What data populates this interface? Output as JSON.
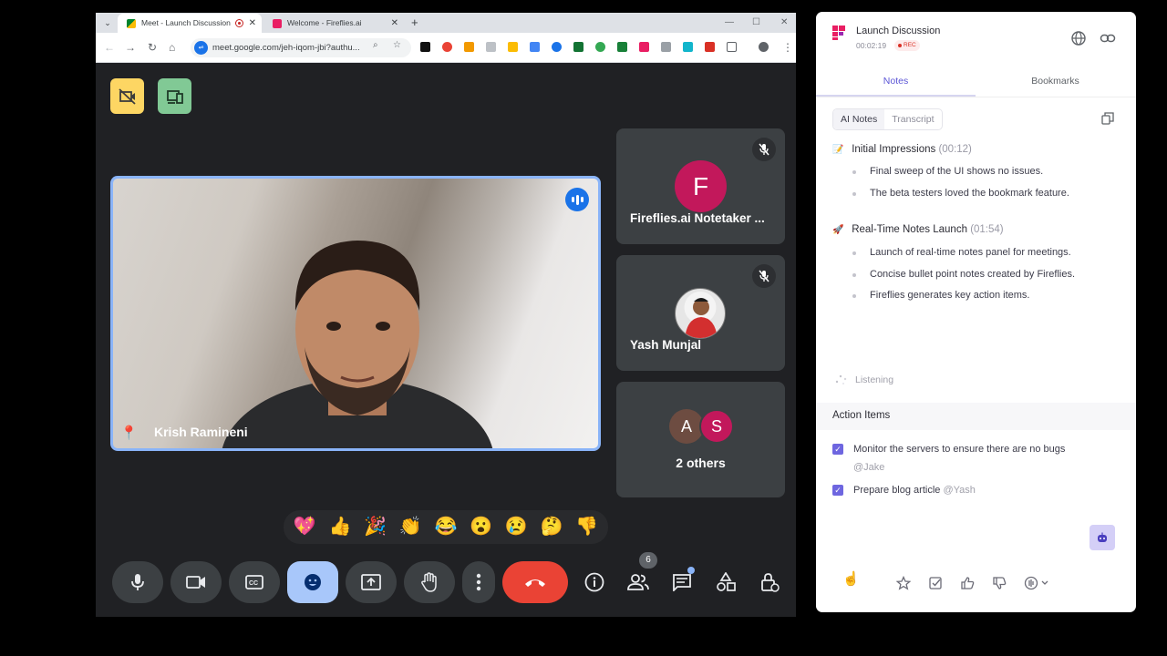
{
  "browser": {
    "tabs": [
      {
        "title": "Meet - Launch Discussion",
        "active": true
      },
      {
        "title": "Welcome - Fireflies.ai",
        "active": false
      }
    ],
    "url": "meet.google.com/jeh-iqom-jbi?authu...",
    "new_tab_label": "+",
    "close_glyph": "✕"
  },
  "meet": {
    "main_participant": {
      "name": "Krish Ramineni",
      "speaking": true
    },
    "side_tiles": [
      {
        "avatar_letter": "F",
        "avatar_color": "#c2185b",
        "name": "Fireflies.ai Notetaker ...",
        "muted": true
      },
      {
        "name": "Yash Munjal",
        "muted": true,
        "avatar": "photo"
      }
    ],
    "others": {
      "letters": [
        "A",
        "S"
      ],
      "colors": [
        "#6d4c41",
        "#c2185b"
      ],
      "label": "2 others"
    },
    "reactions": [
      "💖",
      "👍",
      "🎉",
      "👏",
      "😂",
      "😮",
      "😢",
      "🤔",
      "👎"
    ],
    "people_count": "6",
    "controls": [
      "mic-icon",
      "camera-icon",
      "captions-icon",
      "emoji-icon",
      "present-icon",
      "raise-hand-icon",
      "more-icon",
      "end-call-icon",
      "info-icon",
      "people-icon",
      "chat-icon",
      "activities-icon",
      "host-controls-icon"
    ],
    "colors": {
      "leave": "#ea4335",
      "active_control": "#a8c7fa",
      "tile_border": "#8ab4f8"
    }
  },
  "panel": {
    "title": "Launch Discussion",
    "timer": "00:02:19",
    "rec_label": "REC",
    "tabs": [
      "Notes",
      "Bookmarks"
    ],
    "segments": [
      "AI Notes",
      "Transcript"
    ],
    "sections": [
      {
        "emoji": "📝",
        "title": "Initial Impressions",
        "timestamp": "(00:12)",
        "bullets": [
          "Final sweep of the UI shows no issues.",
          "The beta testers loved the bookmark feature."
        ]
      },
      {
        "emoji": "🚀",
        "title": "Real-Time Notes Launch",
        "timestamp": "(01:54)",
        "bullets": [
          "Launch of real-time notes panel for meetings.",
          "Concise bullet point notes created by Fireflies.",
          "Fireflies generates key action items."
        ]
      }
    ],
    "listening": "Listening",
    "action_items_title": "Action Items",
    "action_items": [
      {
        "text": "Monitor the servers to ensure there are no bugs",
        "mention": "@Jake",
        "checked": true
      },
      {
        "text": "Prepare blog article",
        "mention": "@Yash",
        "checked": true
      }
    ],
    "accent": "#6e66e0"
  }
}
